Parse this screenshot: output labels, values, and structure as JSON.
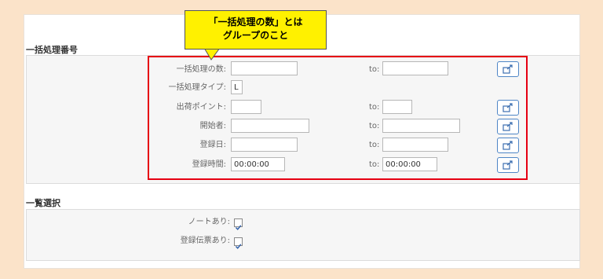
{
  "callout": {
    "line1": "「一括処理の数」とは",
    "line2": "グループのこと"
  },
  "batch_section": {
    "title": "一括処理番号",
    "rows": {
      "count": {
        "label": "一括処理の数:",
        "to_label": "to:",
        "from_value": "",
        "to_value": ""
      },
      "type": {
        "label": "一括処理タイプ:",
        "value": "L"
      },
      "shipping_point": {
        "label": "出荷ポイント:",
        "to_label": "to:",
        "from_value": "",
        "to_value": ""
      },
      "initiator": {
        "label": "開始者:",
        "to_label": "to:",
        "from_value": "",
        "to_value": ""
      },
      "reg_date": {
        "label": "登録日:",
        "to_label": "to:",
        "from_value": "",
        "to_value": ""
      },
      "reg_time": {
        "label": "登録時間:",
        "to_label": "to:",
        "from_value": "00:00:00",
        "to_value": "00:00:00"
      }
    },
    "icon": "multiple-selection-icon",
    "highlight_color": "#e60012"
  },
  "list_section": {
    "title": "一覧選択",
    "note_label": "ノートあり:",
    "note_checked": true,
    "reg_doc_label": "登録伝票あり:",
    "reg_doc_checked": true
  }
}
